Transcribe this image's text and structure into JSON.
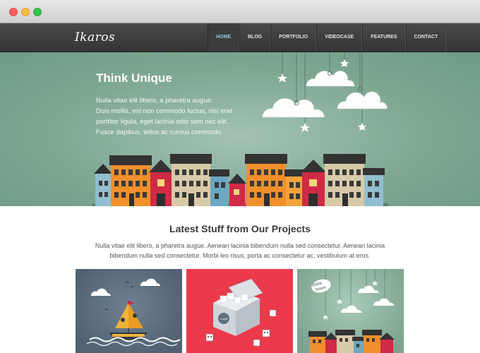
{
  "browser": {
    "controls": [
      "close",
      "minimize",
      "zoom"
    ]
  },
  "site": {
    "logo": "Ikaros",
    "nav": [
      {
        "label": "HOME",
        "active": true
      },
      {
        "label": "BLOG",
        "active": false
      },
      {
        "label": "PORTFOLIO",
        "active": false
      },
      {
        "label": "VIDEOCASE",
        "active": false
      },
      {
        "label": "FEATURES",
        "active": false
      },
      {
        "label": "CONTACT",
        "active": false
      }
    ]
  },
  "hero": {
    "title": "Think Unique",
    "lines": [
      "Nulla vitae elit libero, a pharetra augue.",
      "Duis mollis, est non commodo luctus, nisi erat",
      "porttitor ligula, eget lacinia odio sem nec elit.",
      "Fusce dapibus, tellus ac cursus commodo."
    ],
    "illustration": [
      "cloud-icon",
      "star-icon",
      "house-icon"
    ]
  },
  "projects": {
    "title": "Latest Stuff from Our Projects",
    "lines": [
      "Nulla vitae elit libero, a pharetra augue. Aenean lacinia bibendum nulla sed consectetur. Aenean lacinia",
      "bibendum nulla sed consectetur. Morbi leo risus, porta ac consectetur ac, vestibulum at eros."
    ],
    "thumbnails": [
      {
        "icon": "sailboat-icon"
      },
      {
        "icon": "sugar-box-icon",
        "label": "LUMP SUGAR"
      },
      {
        "icon": "little-town-icon",
        "label": "little town"
      }
    ]
  },
  "colors": {
    "hero_bg": "#7fa893",
    "nav_bg": "#3c3c3e",
    "nav_active_text": "#8fcbd9",
    "thumb_blue": "#506273",
    "thumb_red": "#ec3a4c",
    "thumb_green": "#7da38f"
  }
}
